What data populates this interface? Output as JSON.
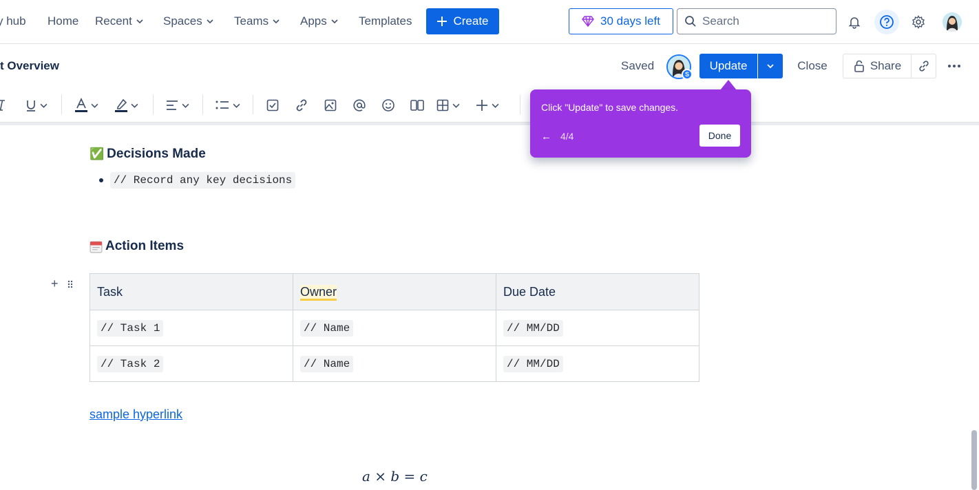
{
  "topnav": {
    "items": [
      {
        "label": "y hub",
        "has_dropdown": false
      },
      {
        "label": "Home",
        "has_dropdown": false
      },
      {
        "label": "Recent",
        "has_dropdown": true
      },
      {
        "label": "Spaces",
        "has_dropdown": true
      },
      {
        "label": "Teams",
        "has_dropdown": true
      },
      {
        "label": "Apps",
        "has_dropdown": true
      },
      {
        "label": "Templates",
        "has_dropdown": false
      }
    ],
    "create_label": "Create",
    "trial_label": "30 days left",
    "search_placeholder": "Search",
    "icons": [
      "bell-icon",
      "help-icon",
      "settings-icon",
      "avatar"
    ]
  },
  "pagebar": {
    "title": "t Overview",
    "saved_label": "Saved",
    "collaborator_initial": "S",
    "update_label": "Update",
    "close_label": "Close",
    "share_label": "Share"
  },
  "toolbar": {
    "tools": [
      "italic",
      "underline",
      "text-color",
      "highlight",
      "align",
      "list",
      "task",
      "link",
      "image",
      "mention",
      "emoji",
      "layout",
      "table",
      "insert"
    ]
  },
  "content": {
    "decisions_heading": "Decisions Made",
    "decisions_emoji": "✅",
    "decisions_item": "// Record any key decisions",
    "actions_heading": "Action Items",
    "actions_emoji": "🗓",
    "table": {
      "headers": [
        "Task",
        "Owner",
        "Due Date"
      ],
      "rows": [
        [
          "// Task 1",
          "// Name",
          "// MM/DD"
        ],
        [
          "// Task 2",
          "// Name",
          "// MM/DD"
        ]
      ]
    },
    "hyperlink": "sample hyperlink",
    "formula": "a × b = c"
  },
  "tour": {
    "text": "Click \"Update\" to save changes.",
    "back": "←",
    "step": "4/4",
    "done_label": "Done"
  },
  "colors": {
    "primary": "#0c66e4",
    "tour_bg": "#9a35e3",
    "highlight": "#f5cd47"
  }
}
